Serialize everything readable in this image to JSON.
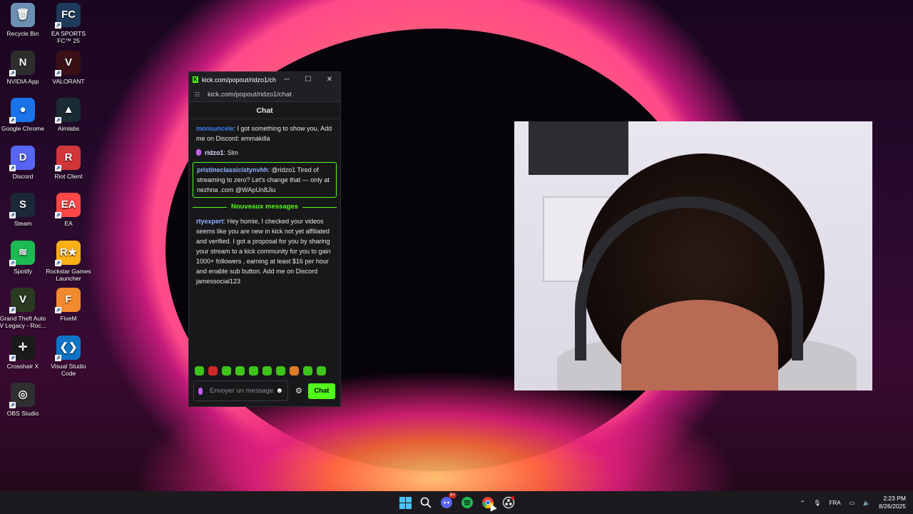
{
  "desktop": {
    "icons": [
      {
        "label": "Recycle Bin",
        "color": "#6c8fb4",
        "glyph": "🗑"
      },
      {
        "label": "EA SPORTS FC™ 25",
        "color": "#1f3a5a",
        "glyph": "FC"
      },
      {
        "label": "NVIDIA App",
        "color": "#2d2d2d",
        "glyph": "N"
      },
      {
        "label": "VALORANT",
        "color": "#3a1016",
        "glyph": "V"
      },
      {
        "label": "Google Chrome",
        "color": "#1a73e8",
        "glyph": "●"
      },
      {
        "label": "Aimlabs",
        "color": "#1a2b33",
        "glyph": "▲"
      },
      {
        "label": "Discord",
        "color": "#5865f2",
        "glyph": "D"
      },
      {
        "label": "Riot Client",
        "color": "#d13639",
        "glyph": "R"
      },
      {
        "label": "Steam",
        "color": "#1b2838",
        "glyph": "S"
      },
      {
        "label": "EA",
        "color": "#ff4747",
        "glyph": "EA"
      },
      {
        "label": "Spotify",
        "color": "#1db954",
        "glyph": "≋"
      },
      {
        "label": "Rockstar Games Launcher",
        "color": "#fcaf17",
        "glyph": "R★"
      },
      {
        "label": "Grand Theft Auto V Legacy - Roc...",
        "color": "#2b3a23",
        "glyph": "V"
      },
      {
        "label": "FiveM",
        "color": "#f38b2e",
        "glyph": "F"
      },
      {
        "label": "Crosshair X",
        "color": "#1a1a1a",
        "glyph": "✛"
      },
      {
        "label": "Visual Studio Code",
        "color": "#0e74c8",
        "glyph": "❮❯"
      },
      {
        "label": "OBS Studio",
        "color": "#302e31",
        "glyph": "◎"
      }
    ]
  },
  "chat_window": {
    "title": "kick.com/popout/ridzo1/ch...",
    "url": "kick.com/popout/ridzo1/chat",
    "header": "Chat",
    "messages": [
      {
        "user": "monsuncele",
        "text": ": I got something to show you, Add me on Discord: emmakilla"
      },
      {
        "user": "ridzo1",
        "text": ": Slm"
      },
      {
        "user": "pristineclassicistynvhh",
        "text": ": @ridzo1 Tired of streaming to zero? Let's change that — only at nezhna .com @WApUn8Jiu"
      }
    ],
    "divider": "Nouveaux messages",
    "new_messages": [
      {
        "user": "rtyexpert",
        "text": ": Hey homie, I checked your videos seems like you are new in kick not yet affiliated and verified. I got a proposal for you by sharing your stream to a kick community for you to gain 1000+ followers , earning at least $16 per hour and enable sub button. Add me on Discord jamessocial123"
      }
    ],
    "input_placeholder": "Envoyer un message",
    "send_label": "Chat"
  },
  "taskbar": {
    "discord_badge": "9+",
    "language": "FRA",
    "time": "2:23 PM",
    "date": "8/26/2025"
  }
}
